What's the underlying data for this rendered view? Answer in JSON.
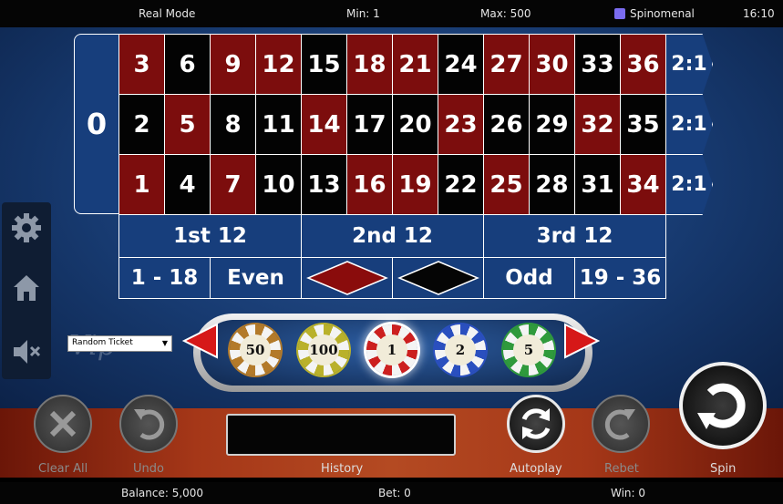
{
  "top_bar": {
    "mode": "Real Mode",
    "min": "Min: 1",
    "max": "Max: 500",
    "brand": "Spinomenal",
    "clock": "16:10"
  },
  "zero": "0",
  "rows": [
    [
      {
        "n": "3",
        "c": "red"
      },
      {
        "n": "6",
        "c": "black"
      },
      {
        "n": "9",
        "c": "red"
      },
      {
        "n": "12",
        "c": "red"
      },
      {
        "n": "15",
        "c": "black"
      },
      {
        "n": "18",
        "c": "red"
      },
      {
        "n": "21",
        "c": "red"
      },
      {
        "n": "24",
        "c": "black"
      },
      {
        "n": "27",
        "c": "red"
      },
      {
        "n": "30",
        "c": "red"
      },
      {
        "n": "33",
        "c": "black"
      },
      {
        "n": "36",
        "c": "red"
      }
    ],
    [
      {
        "n": "2",
        "c": "black"
      },
      {
        "n": "5",
        "c": "red"
      },
      {
        "n": "8",
        "c": "black"
      },
      {
        "n": "11",
        "c": "black"
      },
      {
        "n": "14",
        "c": "red"
      },
      {
        "n": "17",
        "c": "black"
      },
      {
        "n": "20",
        "c": "black"
      },
      {
        "n": "23",
        "c": "red"
      },
      {
        "n": "26",
        "c": "black"
      },
      {
        "n": "29",
        "c": "black"
      },
      {
        "n": "32",
        "c": "red"
      },
      {
        "n": "35",
        "c": "black"
      }
    ],
    [
      {
        "n": "1",
        "c": "red"
      },
      {
        "n": "4",
        "c": "black"
      },
      {
        "n": "7",
        "c": "red"
      },
      {
        "n": "10",
        "c": "black"
      },
      {
        "n": "13",
        "c": "black"
      },
      {
        "n": "16",
        "c": "red"
      },
      {
        "n": "19",
        "c": "red"
      },
      {
        "n": "22",
        "c": "black"
      },
      {
        "n": "25",
        "c": "red"
      },
      {
        "n": "28",
        "c": "black"
      },
      {
        "n": "31",
        "c": "black"
      },
      {
        "n": "34",
        "c": "red"
      }
    ]
  ],
  "column_bets": [
    "2:1",
    "2:1",
    "2:1"
  ],
  "dozens": [
    "1st 12",
    "2nd 12",
    "3rd 12"
  ],
  "outside_bets": {
    "low": "1 - 18",
    "even": "Even",
    "odd": "Odd",
    "high": "19 - 36"
  },
  "colors": {
    "red": "#7c0d0d",
    "black": "#030303",
    "felt": "#173e7c"
  },
  "select": {
    "value": "Random Ticket"
  },
  "vip_logo": "Vip",
  "chips": [
    {
      "value": "50",
      "color": "#b37a2a"
    },
    {
      "value": "100",
      "color": "#b9b12a"
    },
    {
      "value": "1",
      "color": "#cc1f1f"
    },
    {
      "value": "2",
      "color": "#2a4fbf"
    },
    {
      "value": "5",
      "color": "#2f9a3c"
    }
  ],
  "buttons": {
    "clear_all": "Clear All",
    "undo": "Undo",
    "history": "History",
    "autoplay": "Autoplay",
    "rebet": "Rebet",
    "spin": "Spin"
  },
  "bottom_bar": {
    "balance": "Balance: 5,000",
    "bet": "Bet: 0",
    "win": "Win: 0"
  }
}
